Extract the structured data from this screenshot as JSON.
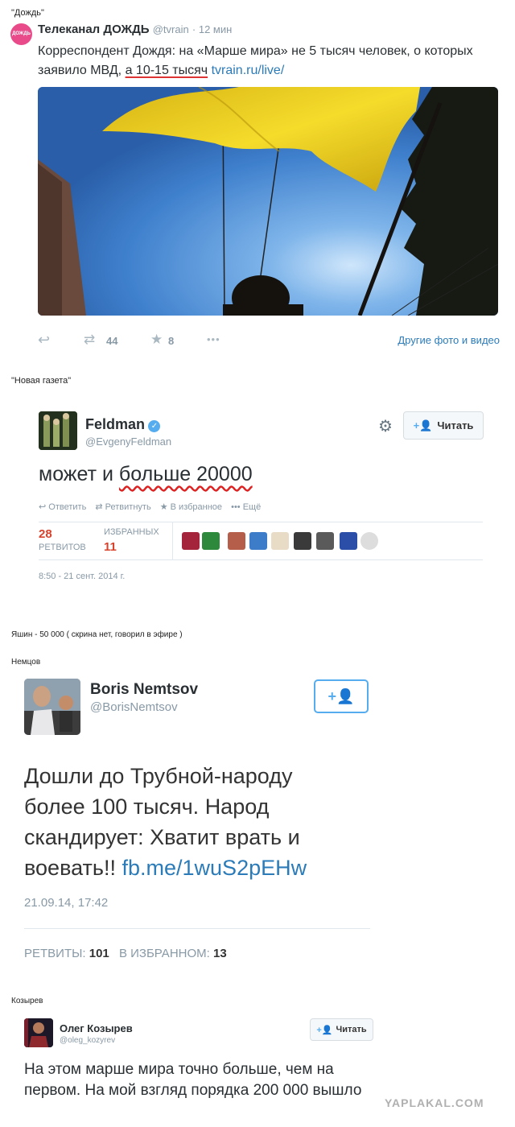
{
  "sections": {
    "dozhd": "\"Дождь\"",
    "novaya": "\"Новая газета\"",
    "yashin": "Яшин - 50 000 ( скрина нет, говорил в эфире )",
    "nemtsov": "Немцов",
    "kozyrev": "Козырев"
  },
  "tweet1": {
    "name": "Телеканал ДОЖДЬ",
    "handle": "@tvrain",
    "time": "· 12 мин",
    "avatar_text": "ДОЖДЬ",
    "text_part1": "Корреспондент Дождя: на «Марше мира» не 5 тысяч человек, о которых заявило МВД,",
    "text_highlight": "а 10-15 тысяч",
    "link": "tvrain.ru/live/",
    "retweets": "44",
    "favorites": "8",
    "more": "•••",
    "media_link": "Другие фото и видео"
  },
  "tweet2": {
    "name": "Feldman",
    "handle": "@EvgenyFeldman",
    "follow_label": "Читать",
    "text_plain": "может и",
    "text_highlight": "больше 20000",
    "reply_label": "Ответить",
    "retweet_label": "Ретвитнуть",
    "favorite_label": "В избранное",
    "more_label": "Ещё",
    "retweets_count": "28",
    "retweets_label": "РЕТВИТОВ",
    "favorites_label": "ИЗБРАННЫХ",
    "favorites_count": "11",
    "timestamp": "8:50 - 21 сент. 2014 г."
  },
  "tweet3": {
    "name": "Boris Nemtsov",
    "handle": "@BorisNemtsov",
    "text": "Дошли до Трубной-народу более 100 тысяч. Народ скандирует: Хватит врать и воевать!!",
    "link": "fb.me/1wuS2pEHw",
    "timestamp": "21.09.14, 17:42",
    "retweets_label": "РЕТВИТЫ:",
    "retweets_count": "101",
    "favorites_label": "В ИЗБРАННОМ:",
    "favorites_count": "13"
  },
  "tweet4": {
    "name": "Олег Козырев",
    "handle": "@oleg_kozyrev",
    "follow_label": "Читать",
    "text": "На этом марше мира точно больше, чем на первом. На мой взгляд порядка 200 000 вышло"
  },
  "watermark": "YAPLAKAL.COM",
  "colors": {
    "link": "#2b7bb9",
    "retweet_count": "#d8432d",
    "underline": "#dd2222",
    "flag": "#f1d21b",
    "sky": "#4f8fd6"
  }
}
